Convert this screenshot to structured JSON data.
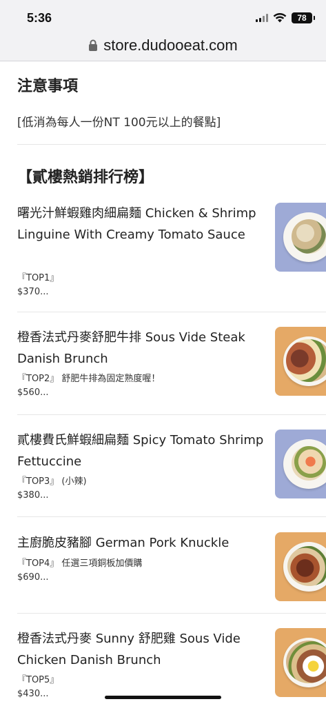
{
  "status_bar": {
    "time": "5:36",
    "battery": "78"
  },
  "url_bar": {
    "domain": "store.dudooeat.com"
  },
  "notice": {
    "title": "注意事項",
    "text": "[低消為每人一份NT 100元以上的餐點]"
  },
  "section": {
    "title": "【貳樓熱銷排行榜】"
  },
  "menu_items": [
    {
      "name": "曙光汁鮮蝦雞肉細扁麵 Chicken & Shrimp Linguine With Creamy Tomato Sauce",
      "subtitle": "『TOP1』",
      "price": "$370..."
    },
    {
      "name": "橙香法式丹麥舒肥牛排 Sous Vide Steak Danish Brunch",
      "subtitle": "『TOP2』 舒肥牛排為固定熟度喔！",
      "price": "$560..."
    },
    {
      "name": "貳樓費氏鮮蝦細扁麵 Spicy Tomato Shrimp Fettuccine",
      "subtitle": "『TOP3』 (小辣)",
      "price": "$380..."
    },
    {
      "name": "主廚脆皮豬腳 German Pork Knuckle",
      "subtitle": "『TOP4』 任選三項銅板加價購",
      "price": "$690..."
    },
    {
      "name": "橙香法式丹麥 Sunny 舒肥雞 Sous Vide Chicken Danish Brunch",
      "subtitle": "『TOP5』",
      "price": "$430..."
    }
  ],
  "colors": {
    "thumb_blue": "#9eaad6",
    "thumb_orange": "#e5a966",
    "divider": "#e6e6e6"
  }
}
